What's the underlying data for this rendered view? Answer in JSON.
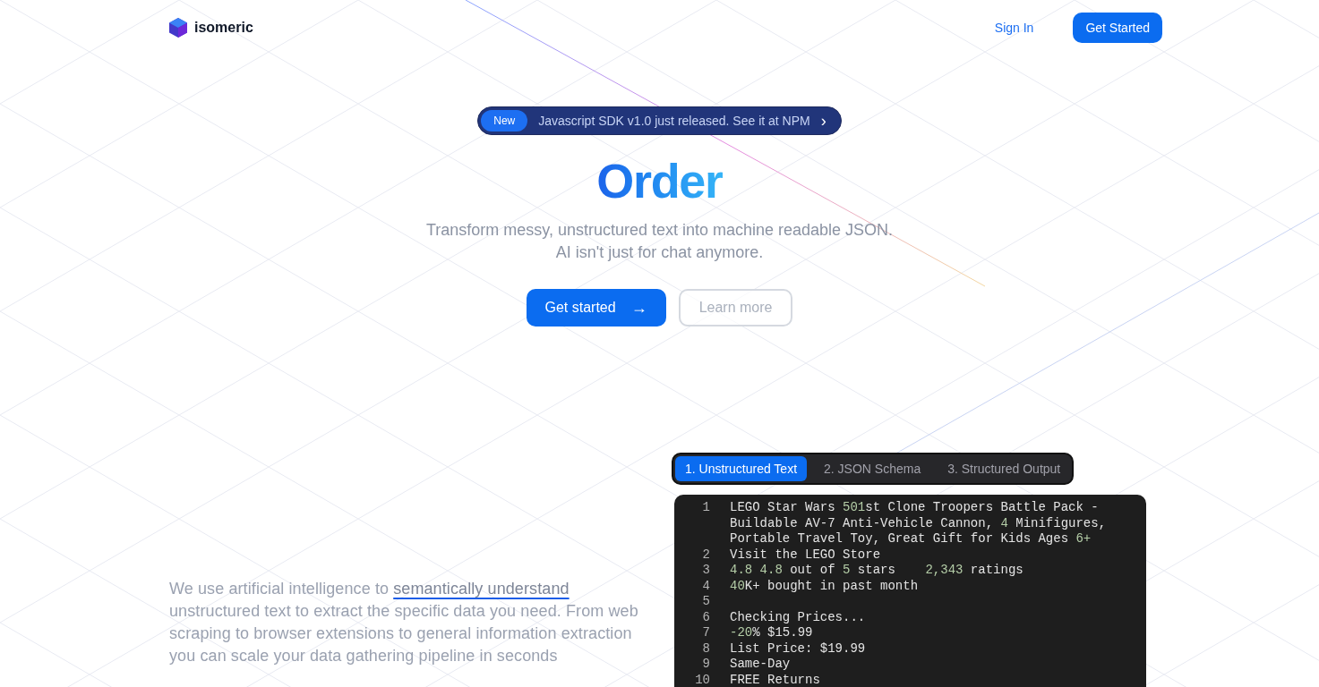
{
  "header": {
    "brand": "isomeric",
    "nav": [
      {
        "label": "Sign In",
        "kind": "link"
      },
      {
        "label": "Get Started",
        "kind": "button"
      }
    ]
  },
  "announcement": {
    "badge": "New",
    "text": "Javascript SDK v1.0 just released. See it at NPM",
    "arrow": "›"
  },
  "hero": {
    "title": "Order",
    "subtitle": [
      "Transform messy, unstructured text into machine readable JSON.",
      "AI isn't just for chat anymore."
    ],
    "buttons": [
      {
        "label": "Get started",
        "kind": "primary",
        "arrow": "→"
      },
      {
        "label": "Learn more",
        "kind": "outline"
      }
    ]
  },
  "description": {
    "before": "We use artificial intelligence to ",
    "link": "semantically understand",
    "after": " unstructured text to extract the specific data you need. From web scraping to browser extensions to general information extraction you can scale your data gathering pipeline in seconds"
  },
  "demo": {
    "tabs": [
      {
        "label": "1. Unstructured Text",
        "selected": true
      },
      {
        "label": "2. JSON Schema",
        "selected": false
      },
      {
        "label": "3. Structured Output",
        "selected": false
      }
    ],
    "lines": [
      {
        "number": "1",
        "segments": [
          {
            "text": "LEGO Star Wars ",
            "kind": "plain"
          },
          {
            "text": "501",
            "kind": "num"
          },
          {
            "text": "st Clone Troopers Battle Pack - Buildable AV-7 Anti-Vehicle Cannon, ",
            "kind": "plain"
          },
          {
            "text": "4",
            "kind": "num"
          },
          {
            "text": " Minifigures, Portable Travel Toy, Great Gift for Kids Ages ",
            "kind": "plain"
          },
          {
            "text": "6+",
            "kind": "num"
          }
        ]
      },
      {
        "number": "2",
        "segments": [
          {
            "text": "Visit the LEGO Store",
            "kind": "plain"
          }
        ]
      },
      {
        "number": "3",
        "segments": [
          {
            "text": "4.8 4.8",
            "kind": "num"
          },
          {
            "text": " out of ",
            "kind": "plain"
          },
          {
            "text": "5",
            "kind": "num"
          },
          {
            "text": " stars    ",
            "kind": "plain"
          },
          {
            "text": "2,343",
            "kind": "num"
          },
          {
            "text": " ratings",
            "kind": "plain"
          }
        ]
      },
      {
        "number": "4",
        "segments": [
          {
            "text": "40",
            "kind": "num"
          },
          {
            "text": "K+ bought in past month",
            "kind": "plain"
          }
        ]
      },
      {
        "number": "5"
      },
      {
        "number": "6",
        "segments": [
          {
            "text": "Checking Prices...",
            "kind": "plain"
          }
        ]
      },
      {
        "number": "7",
        "segments": [
          {
            "text": "-20",
            "kind": "num"
          },
          {
            "text": "% $15.99",
            "kind": "plain"
          }
        ]
      },
      {
        "number": "8",
        "segments": [
          {
            "text": "List Price: $19.99",
            "kind": "plain"
          }
        ]
      },
      {
        "number": "9",
        "segments": [
          {
            "text": "Same-Day",
            "kind": "plain"
          }
        ]
      },
      {
        "number": "10",
        "segments": [
          {
            "text": "FREE Returns",
            "kind": "plain"
          }
        ]
      }
    ]
  }
}
